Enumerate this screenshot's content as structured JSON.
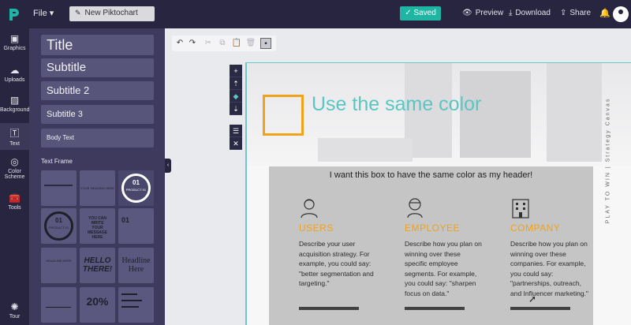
{
  "topbar": {
    "file_label": "File ▾",
    "doc_title": "New Piktochart",
    "saved_label": "Saved",
    "preview_label": "Preview",
    "download_label": "Download",
    "share_label": "Share"
  },
  "rail": [
    {
      "label": "Graphics",
      "icon": "graphics-icon"
    },
    {
      "label": "Uploads",
      "icon": "upload-icon"
    },
    {
      "label": "Background",
      "icon": "background-icon"
    },
    {
      "label": "Text",
      "icon": "text-icon"
    },
    {
      "label": "Color Scheme",
      "icon": "palette-icon"
    },
    {
      "label": "Tools",
      "icon": "toolbox-icon"
    },
    {
      "label": "Tour",
      "icon": "tour-icon"
    }
  ],
  "panel": {
    "title_label": "Title",
    "subtitle_label": "Subtitle",
    "subtitle2_label": "Subtitle 2",
    "subtitle3_label": "Subtitle 3",
    "body_label": "Body Text",
    "frames_heading": "Text Frame",
    "frames": {
      "f2": "YOUR HEADING HERE",
      "f3a": "01",
      "f3b": "PRODUCT 01",
      "f4a": "01",
      "f4b": "PRODUCT 01",
      "f5": "YOU CAN WRITE YOUR MESSAGE HERE",
      "f6": "01",
      "f7": "HEADLINE HERE",
      "f8": "HELLO THERE!",
      "f9a": "Headline",
      "f9b": "Here",
      "f11": "20%"
    }
  },
  "canvas": {
    "header_title": "Use the same color",
    "side_text": "PLAY TO WIN | Strategy Canvas",
    "box_header": "I want this box to have the same color as my header!",
    "columns": [
      {
        "title": "USERS",
        "text": "Describe your user acquisition strategy. For example, you could say: \"better segmentation and targeting.\""
      },
      {
        "title": "EMPLOYEE",
        "text": "Describe how you plan on winning over these specific employee segments. For example, you could say: \"sharpen focus on data.\""
      },
      {
        "title": "COMPANY",
        "text": "Describe how you plan on winning over these companies. For example, you could say: \"partnerships, outreach, and Influencer marketing.\""
      }
    ]
  },
  "colors": {
    "accent_teal": "#1fb5a3",
    "header_teal": "#5bc5c2",
    "orange": "#f0a21a",
    "dark_navy": "#27253f"
  }
}
